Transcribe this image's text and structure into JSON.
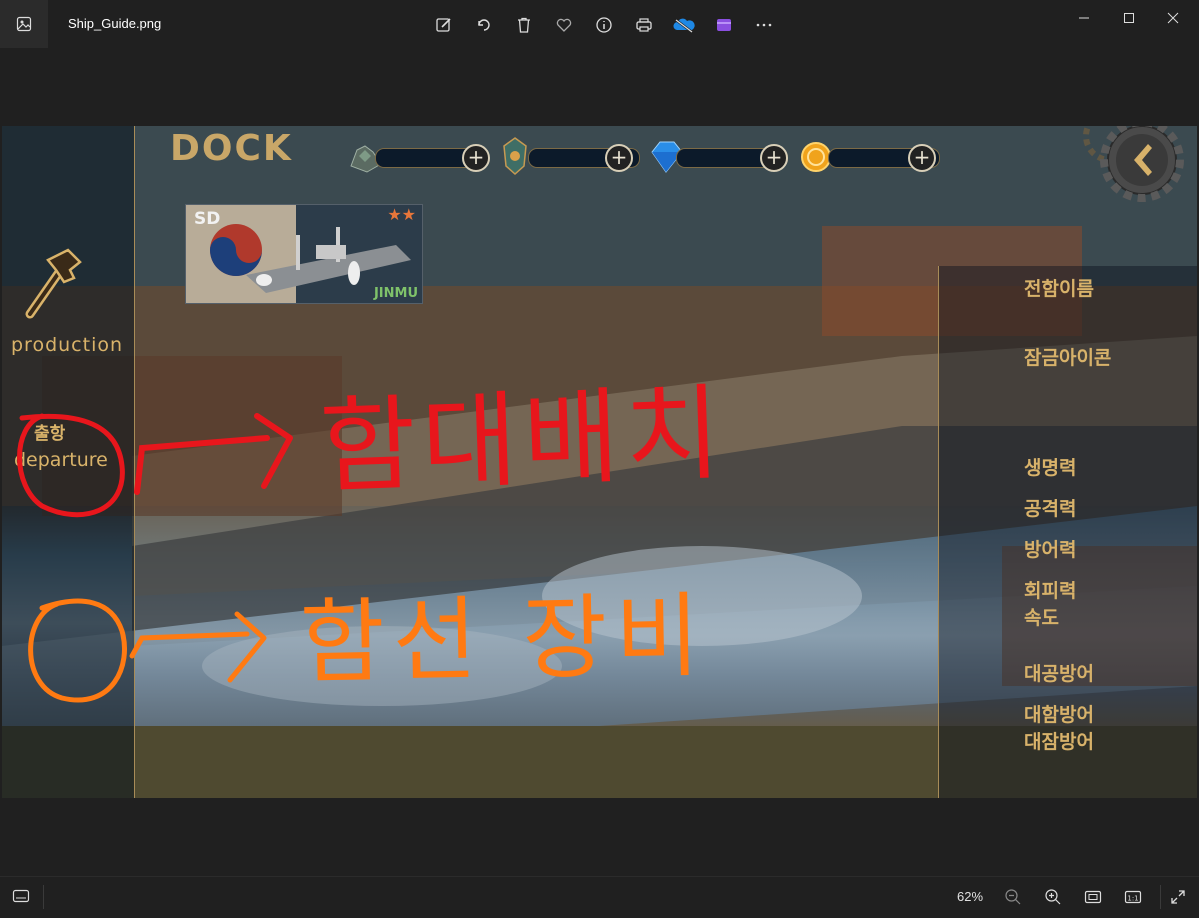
{
  "window": {
    "filename": "Ship_Guide.png",
    "controls": [
      "minimize",
      "maximize",
      "close"
    ]
  },
  "toolbar": {
    "icons": [
      "edit-icon",
      "rotate-icon",
      "delete-icon",
      "favorite-icon",
      "info-icon",
      "print-icon",
      "onedrive-icon",
      "clipchamp-icon",
      "more-icon"
    ]
  },
  "game": {
    "dock_title": "DOCK",
    "production_label": "production",
    "departure_kr": "출항",
    "departure_en": "departure",
    "ship": {
      "class": "SD",
      "name": "JINMU",
      "stars": "★★"
    },
    "resources": [
      "ore-resource",
      "crest-resource",
      "gem-resource",
      "coin-resource"
    ],
    "right_labels": {
      "ship_name": "전함이름",
      "lock_icon": "잠금아이콘",
      "hp": "생명력",
      "attack": "공격력",
      "defense": "방어력",
      "evasion": "회피력",
      "speed": "속도",
      "anti_air": "대공방어",
      "anti_ship": "대함방어",
      "anti_sub": "대잠방어"
    }
  },
  "annotations": {
    "red_text": "함대배치",
    "orange_text": "함선 장비",
    "red_color": "#e8161c",
    "orange_color": "#ff7a12"
  },
  "statusbar": {
    "zoom": "62%"
  }
}
